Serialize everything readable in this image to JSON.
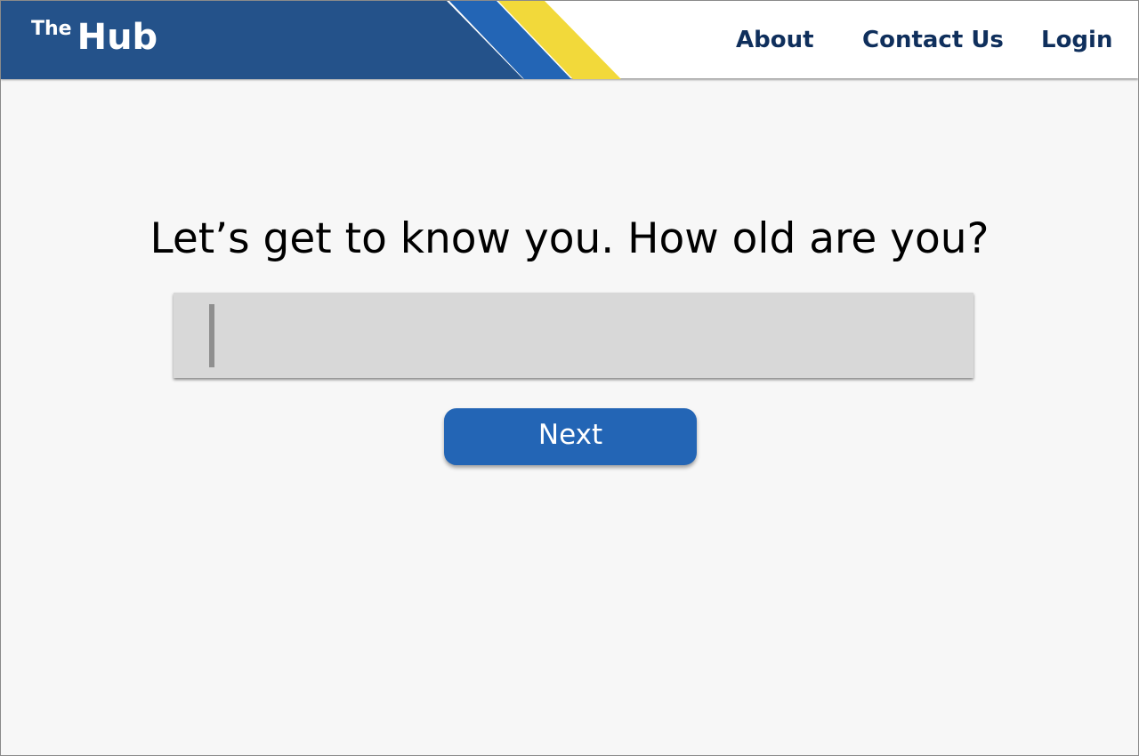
{
  "header": {
    "logo_small": "The",
    "logo_large": "Hub",
    "nav": {
      "about": "About",
      "contact": "Contact Us",
      "login": "Login"
    }
  },
  "main": {
    "question": "Let’s get to know you. How old are you?",
    "age_input_value": "",
    "next_label": "Next"
  },
  "colors": {
    "banner_navy": "#24528a",
    "stripe_blue": "#2365b5",
    "stripe_yellow": "#f2d93a",
    "nav_text": "#0f2f5c",
    "button": "#2365b5",
    "input_bg": "#d8d8d8",
    "page_bg": "#f7f7f7"
  }
}
